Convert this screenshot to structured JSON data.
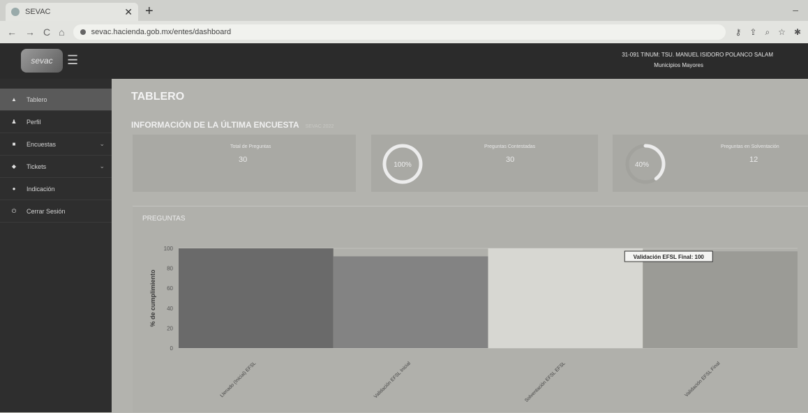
{
  "browser": {
    "tab_title": "SEVAC",
    "tab_close": "✕",
    "new_tab": "+",
    "window_controls": "–",
    "nav_back": "←",
    "nav_forward": "→",
    "nav_reload": "C",
    "nav_home": "⌂",
    "url": "sevac.hacienda.gob.mx/entes/dashboard"
  },
  "header": {
    "logo_text": "sevac",
    "user_line": "31-091 TINUM: TSU. MANUEL ISIDORO POLANCO SALAM",
    "user_sub": "Municipios Mayores"
  },
  "sidebar": {
    "items": [
      {
        "label": "Tablero",
        "icon": "home-icon"
      },
      {
        "label": "Perfil",
        "icon": "user-icon"
      },
      {
        "label": "Encuestas",
        "icon": "file-icon"
      },
      {
        "label": "Tickets",
        "icon": "ticket-icon"
      },
      {
        "label": "Indicación",
        "icon": "dot-icon"
      },
      {
        "label": "Cerrar Sesión",
        "icon": "power-icon"
      }
    ]
  },
  "main": {
    "page_title": "TABLERO",
    "section_title": "INFORMACIÓN DE LA ÚLTIMA ENCUESTA",
    "section_badge": "SEVAC 2022",
    "cards": [
      {
        "label": "Total de Preguntas",
        "value": "30"
      },
      {
        "label": "Preguntas Contestadas",
        "value": "30",
        "percent_text": "100%",
        "percent": 1.0
      },
      {
        "label": "Preguntas en Solventación",
        "value": "12",
        "percent_text": "40%",
        "percent": 0.4
      }
    ],
    "panel_title": "PREGUNTAS",
    "tooltip": "Validación EFSL Final: 100"
  },
  "chart_data": {
    "type": "bar",
    "ylabel": "% de cumplimiento",
    "ylim": [
      0,
      100
    ],
    "yticks": [
      "0",
      "20",
      "40",
      "60",
      "80",
      "100"
    ],
    "categories": [
      "Llenado (Inicial) EFSL",
      "Validación EFSL Inicial",
      "Solventación EFSL EFSL",
      "Validación EFSL Final"
    ],
    "values": [
      100,
      92,
      100,
      97
    ],
    "colors": [
      "#6a6a6a",
      "#838383",
      "#d7d7d2",
      "#9b9b96"
    ]
  }
}
